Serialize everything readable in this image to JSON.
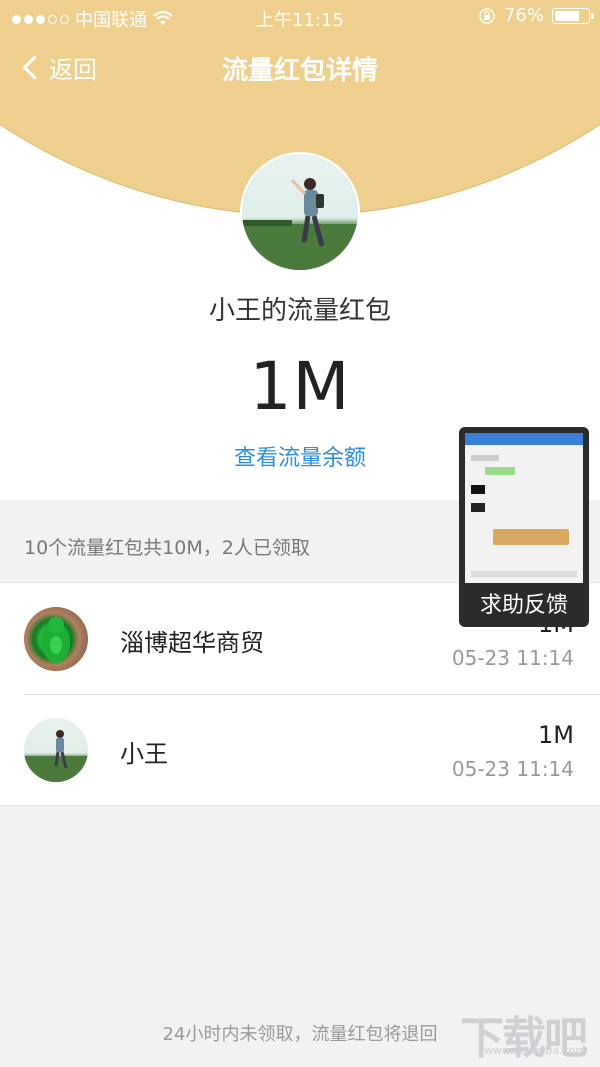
{
  "status_bar": {
    "carrier": "中国联通",
    "time": "上午11:15",
    "battery": "76%",
    "signal_dots_filled": 3,
    "signal_dots_total": 5
  },
  "nav": {
    "back_label": "返回",
    "title": "流量红包详情"
  },
  "header": {
    "owner_title": "小王的流量红包",
    "amount": "1M",
    "check_balance_link": "查看流量余额"
  },
  "summary": "10个流量红包共10M，2人已领取",
  "recipients": [
    {
      "name": "淄博超华商贸",
      "amount": "1M",
      "time": "05-23 11:14"
    },
    {
      "name": "小王",
      "amount": "1M",
      "time": "05-23 11:14"
    }
  ],
  "floating_help": {
    "label": "求助反馈"
  },
  "footer_note": "24小时内未领取，流量红包将退回",
  "watermark": {
    "text": "下载吧",
    "url_text": "www.xiazaiba.com"
  },
  "colors": {
    "header_gold": "#eecf8d",
    "link_blue": "#2e8fd8",
    "background": "#f2f2f5"
  }
}
